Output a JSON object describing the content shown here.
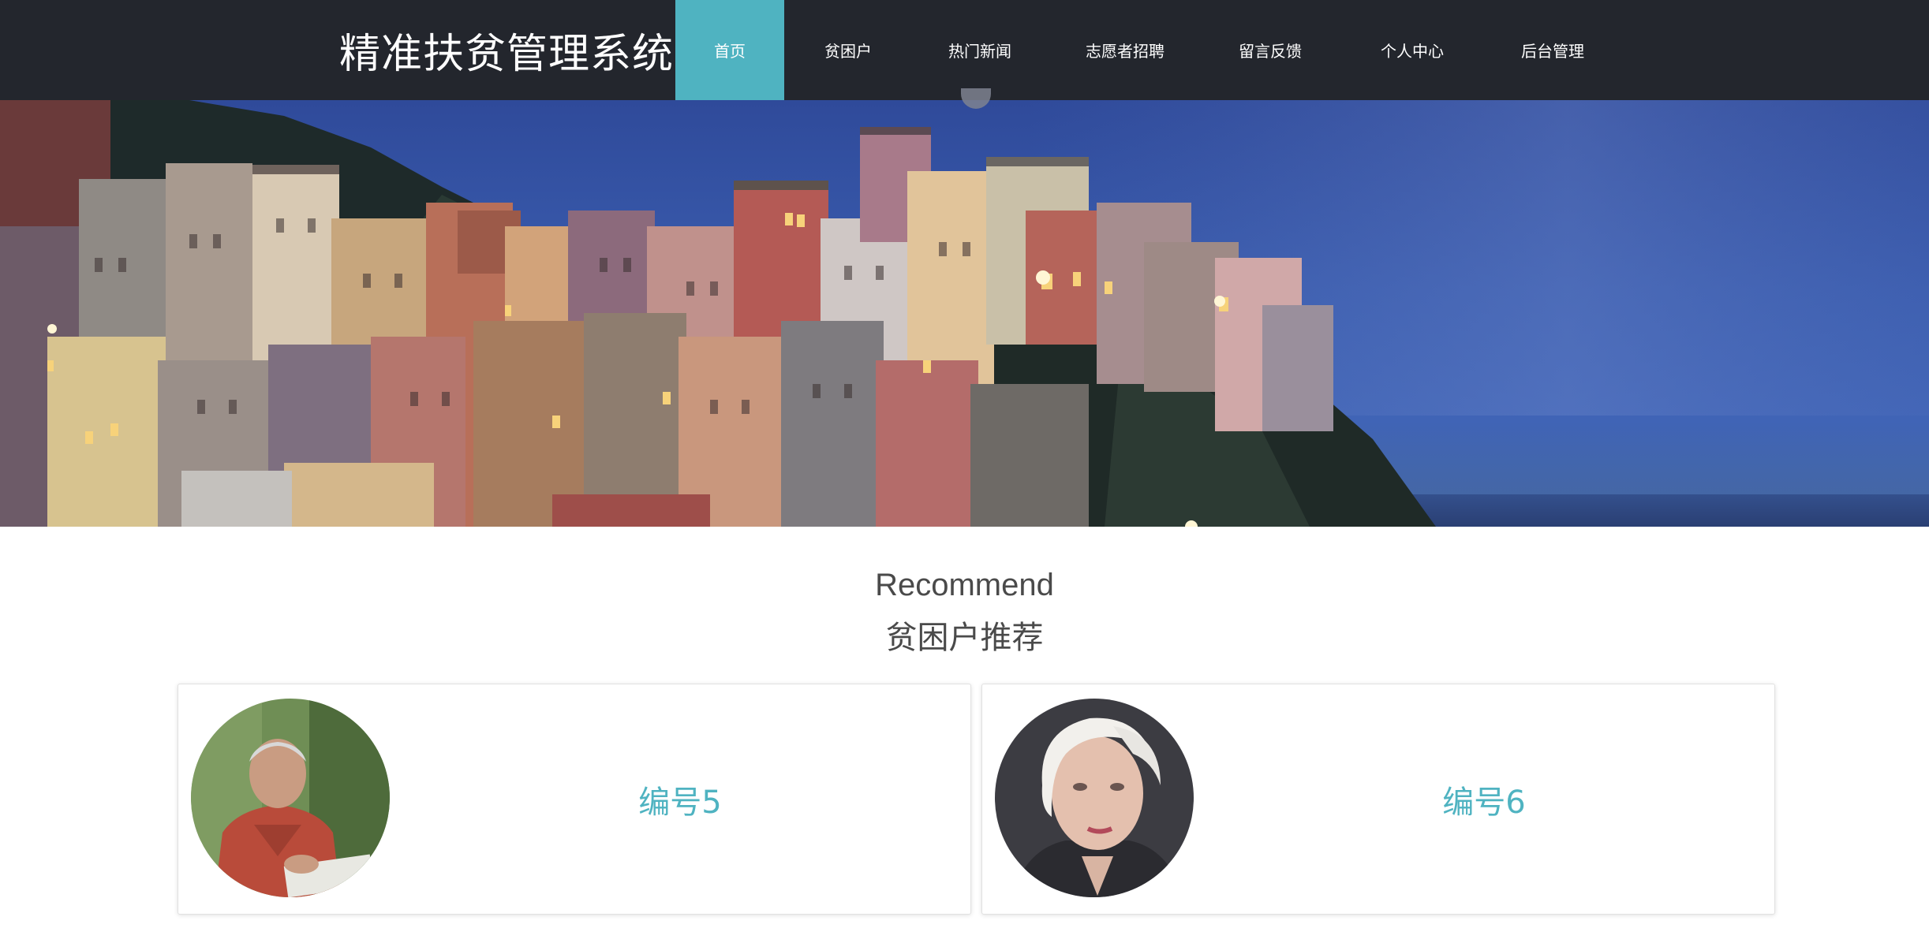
{
  "header": {
    "brand": "精准扶贫管理系统",
    "nav": [
      {
        "label": "首页",
        "active": true
      },
      {
        "label": "贫困户",
        "active": false
      },
      {
        "label": "热门新闻",
        "active": false
      },
      {
        "label": "志愿者招聘",
        "active": false
      },
      {
        "label": "留言反馈",
        "active": false
      },
      {
        "label": "个人中心",
        "active": false
      },
      {
        "label": "后台管理",
        "active": false
      }
    ]
  },
  "banner": {
    "image": "coastal-village-night-photo",
    "arrow_icon": "chevron-down-icon"
  },
  "recommend": {
    "title_en": "Recommend",
    "title_zh": "贫困户推荐",
    "cards": [
      {
        "title": "编号5",
        "avatar": "elderly-man-reading-newspaper-photo"
      },
      {
        "title": "编号6",
        "avatar": "elderly-woman-white-hair-photo"
      }
    ]
  },
  "colors": {
    "nav_bg": "#23262d",
    "accent": "#4fb3c1",
    "heading": "#4a4a4a"
  }
}
